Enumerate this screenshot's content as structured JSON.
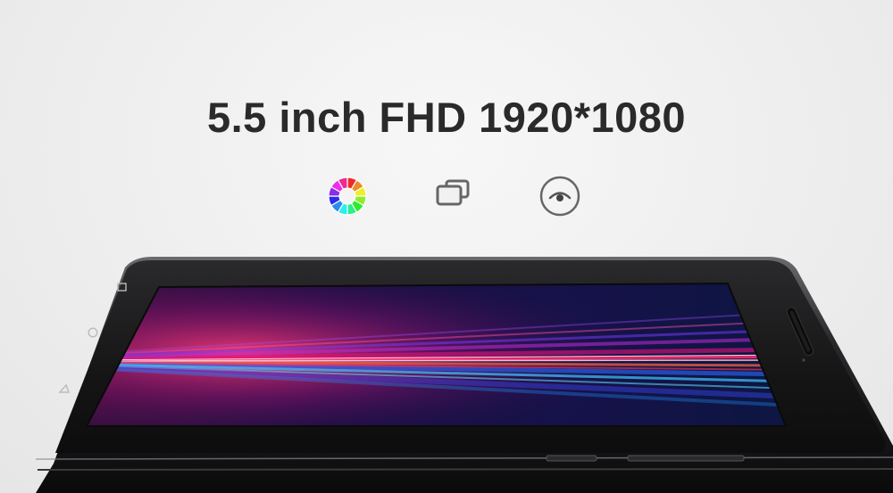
{
  "headline": "5.5 inch FHD 1920*1080",
  "features": [
    {
      "icon": "color-wheel-icon"
    },
    {
      "icon": "stacked-windows-icon"
    },
    {
      "icon": "eye-care-icon"
    }
  ],
  "phone": {
    "nav_buttons": [
      "recent-apps-icon",
      "home-icon",
      "back-icon"
    ],
    "colors": {
      "body": "#1b1b1d",
      "screen_dark": "#1a0d3a",
      "accent_magenta": "#e0137a",
      "accent_blue": "#2a6bff",
      "accent_cyan": "#41c7ff"
    }
  }
}
